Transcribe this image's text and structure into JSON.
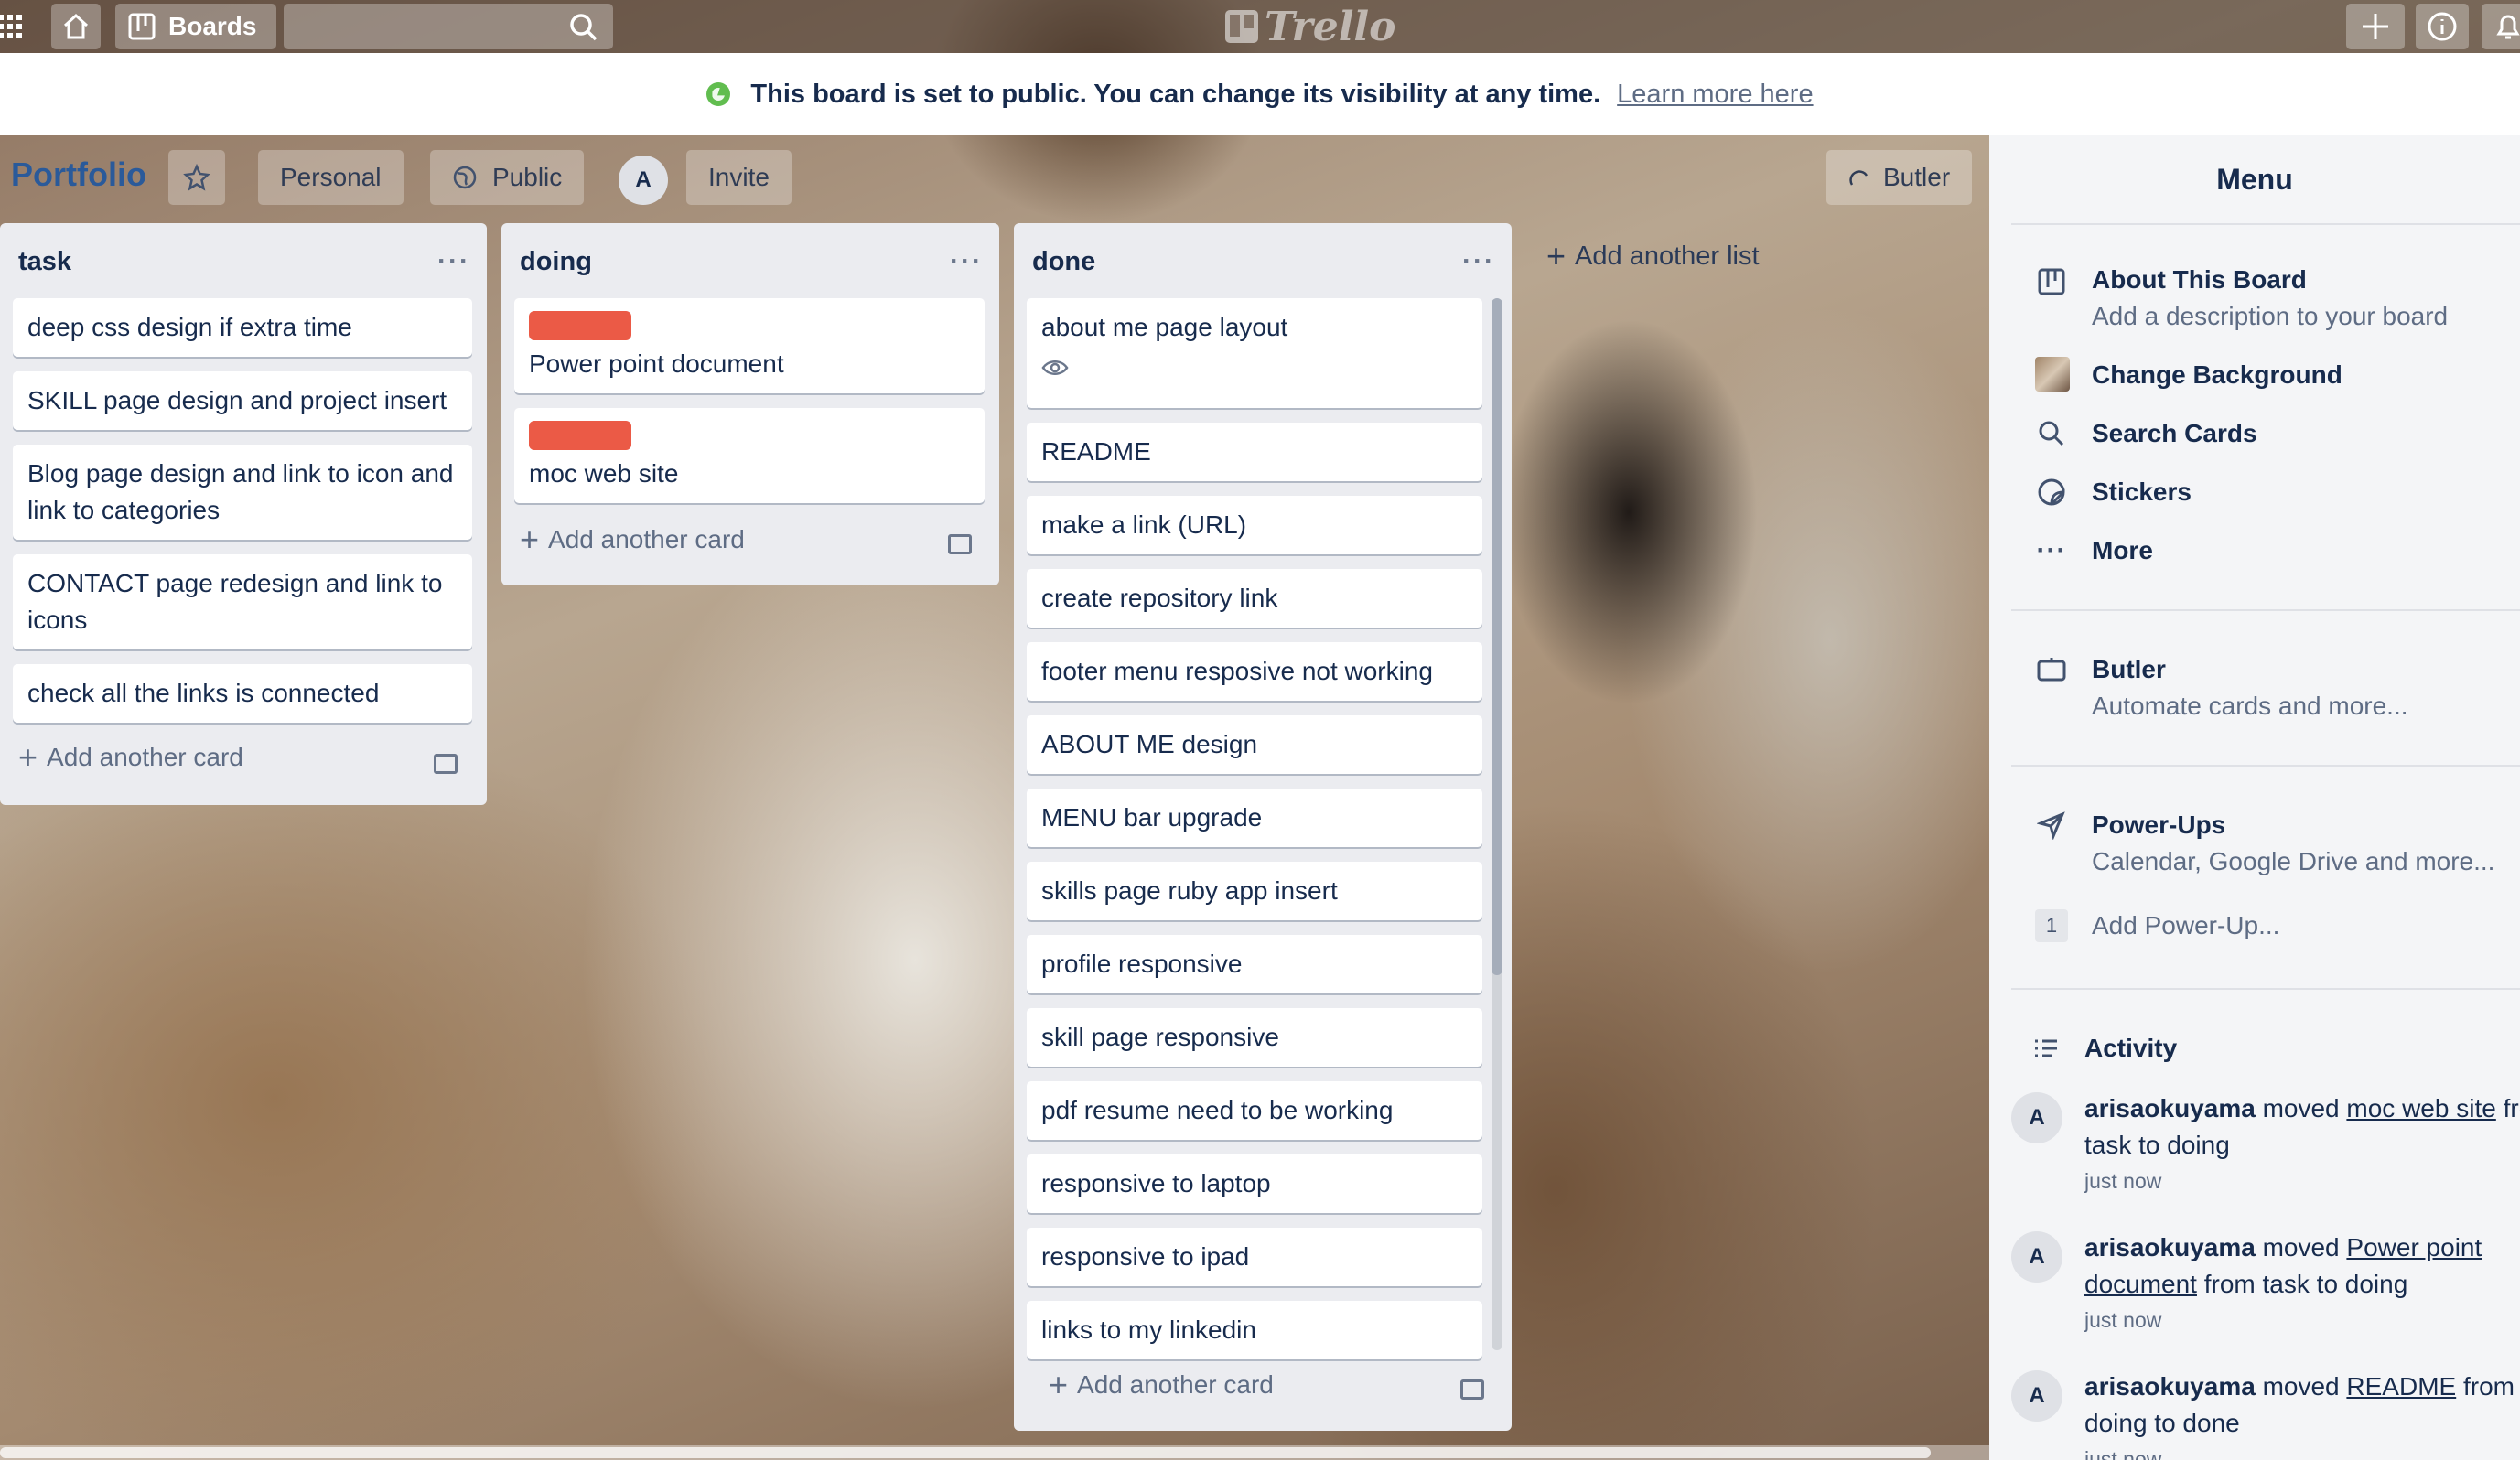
{
  "topbar": {
    "boards_label": "Boards",
    "search_value": "",
    "logo_text": "Trello"
  },
  "banner": {
    "message": "This board is set to public. You can change its visibility at any time.",
    "link": "Learn more here"
  },
  "board": {
    "title": "Portfolio",
    "team_label": "Personal",
    "visibility_label": "Public",
    "member_initial": "A",
    "invite_label": "Invite",
    "butler_label": "Butler"
  },
  "lists": [
    {
      "name": "task",
      "cards": [
        {
          "title": "deep css design if extra time"
        },
        {
          "title": "SKILL page design and project insert"
        },
        {
          "title": "Blog page design and link to icon and link to categories"
        },
        {
          "title": "CONTACT page redesign and link to icons"
        },
        {
          "title": "check all the links is connected"
        }
      ],
      "add_card_label": "Add another card"
    },
    {
      "name": "doing",
      "cards": [
        {
          "title": "Power point document",
          "label_color": "#eb5a46"
        },
        {
          "title": "moc web site",
          "label_color": "#eb5a46"
        }
      ],
      "add_card_label": "Add another card"
    },
    {
      "name": "done",
      "cards": [
        {
          "title": "about me page layout",
          "badge": "eye-icon"
        },
        {
          "title": "README"
        },
        {
          "title": "make a link (URL)"
        },
        {
          "title": "create repository link"
        },
        {
          "title": "footer menu resposive not working"
        },
        {
          "title": "ABOUT ME design"
        },
        {
          "title": "MENU bar upgrade"
        },
        {
          "title": "skills page ruby app insert"
        },
        {
          "title": "profile responsive"
        },
        {
          "title": "skill page responsive"
        },
        {
          "title": "pdf resume need to be working"
        },
        {
          "title": "responsive to laptop"
        },
        {
          "title": "responsive to ipad"
        },
        {
          "title": "links to my linkedin"
        }
      ],
      "add_card_label": "Add another card"
    }
  ],
  "add_list_label": "Add another list",
  "sidebar": {
    "title": "Menu",
    "about": {
      "title": "About This Board",
      "subtitle": "Add a description to your board"
    },
    "change_background": "Change Background",
    "search_cards": "Search Cards",
    "stickers": "Stickers",
    "more": "More",
    "butler": {
      "title": "Butler",
      "subtitle": "Automate cards and more..."
    },
    "powerups": {
      "title": "Power-Ups",
      "subtitle": "Calendar, Google Drive and more..."
    },
    "add_powerup": {
      "count": "1",
      "label": "Add Power-Up..."
    },
    "activity_title": "Activity",
    "activity": [
      {
        "user": "arisaokuyama",
        "verb": "moved",
        "card": "moc web site",
        "rest": "from task to doing",
        "time": "just now"
      },
      {
        "user": "arisaokuyama",
        "verb": "moved",
        "card": "Power point document",
        "rest": "from task to doing",
        "time": "just now"
      },
      {
        "user": "arisaokuyama",
        "verb": "moved",
        "card": "README",
        "rest": "from doing to done",
        "time": "just now"
      }
    ],
    "avatar_initial": "A"
  },
  "colors": {
    "label_red": "#eb5a46",
    "public_green": "#61bd4f",
    "title_blue": "#2a5a9a"
  }
}
